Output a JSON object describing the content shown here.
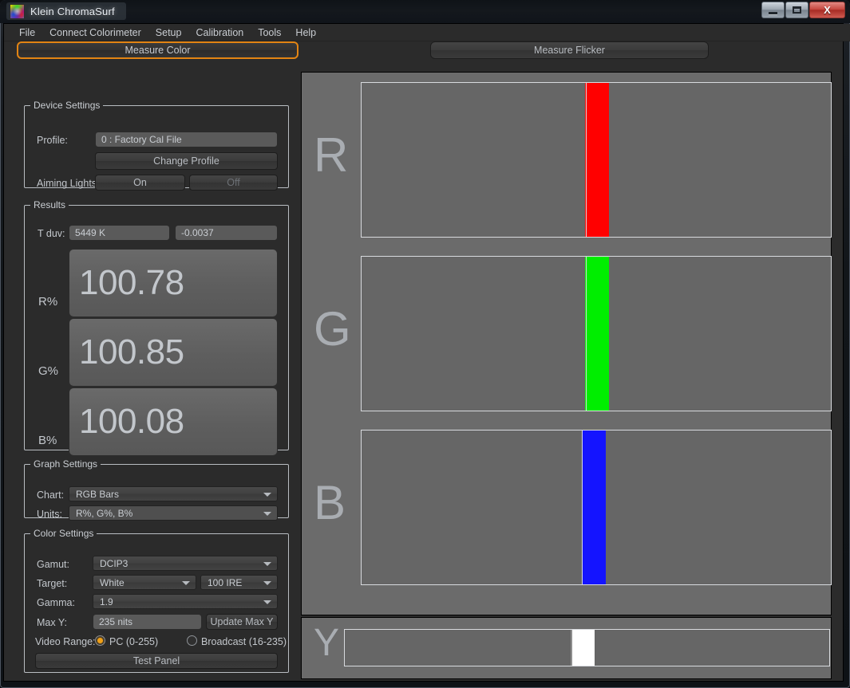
{
  "window": {
    "title": "Klein ChromaSurf",
    "icon": "chromaticity-gradient-icon",
    "minimize_label": "Minimize",
    "maximize_label": "Maximize",
    "close_label": "X"
  },
  "menu": {
    "items": [
      {
        "label": "File"
      },
      {
        "label": "Connect Colorimeter"
      },
      {
        "label": "Setup"
      },
      {
        "label": "Calibration"
      },
      {
        "label": "Tools"
      },
      {
        "label": "Help"
      }
    ]
  },
  "modes": {
    "measure_color": "Measure Color",
    "measure_flicker": "Measure Flicker",
    "active": "Measure Color",
    "active_color": "#e28413"
  },
  "device_settings": {
    "title": "Device Settings",
    "profile_label": "Profile:",
    "profile_value": "0 : Factory Cal File",
    "change_profile_button": "Change Profile",
    "aiming_lights_label": "Aiming Lights:",
    "aiming_on": "On",
    "aiming_off": "Off",
    "aiming_selected": "On"
  },
  "results": {
    "title": "Results",
    "tduv_label": "T duv:",
    "temperature": "5449 K",
    "duv": "-0.0037",
    "r_label": "R%",
    "r_value": "100.78",
    "g_label": "G%",
    "g_value": "100.85",
    "b_label": "B%",
    "b_value": "100.08"
  },
  "graph_settings": {
    "title": "Graph Settings",
    "chart_label": "Chart:",
    "chart_value": "RGB Bars",
    "units_label": "Units:",
    "units_value": "R%, G%, B%"
  },
  "color_settings": {
    "title": "Color Settings",
    "gamut_label": "Gamut:",
    "gamut_value": "DCIP3",
    "target_label": "Target:",
    "target_value": "White",
    "target_ire_value": "100 IRE",
    "gamma_label": "Gamma:",
    "gamma_value": "1.9",
    "maxy_label": "Max Y:",
    "maxy_value": "235 nits",
    "update_maxy_button": "Update Max Y",
    "video_range_label": "Video Range:",
    "video_range_pc": "PC (0-255)",
    "video_range_broadcast": "Broadcast (16-235)",
    "video_range_selected": "PC (0-255)",
    "test_panel_button": "Test Panel"
  },
  "chart_data": {
    "type": "bar",
    "title": "RGB Bars",
    "orientation": "horizontal",
    "units": "R%, G%, B%",
    "xlim": [
      0,
      200
    ],
    "grid": false,
    "legend": null,
    "categories": [
      "R",
      "G",
      "B",
      "Y"
    ],
    "series": [
      {
        "name": "R%",
        "value": 100.78,
        "color": "#ff0000",
        "reference": 100
      },
      {
        "name": "G%",
        "value": 100.85,
        "color": "#00ee00",
        "reference": 100
      },
      {
        "name": "B%",
        "value": 100.08,
        "color": "#1414ff",
        "reference": 100
      },
      {
        "name": "Y",
        "value": 100.0,
        "color": "#ffffff",
        "reference": 100
      }
    ],
    "reference_line_color": "#d8dade",
    "plot_background": "#666666",
    "panel_background": "#6b6b6b"
  },
  "channels": [
    {
      "letter": "R",
      "name": "red-channel",
      "color": "#ff0000",
      "bar_left_pct": 47.6,
      "bar_width_pct": 5.2,
      "split_pct": 2.3
    },
    {
      "letter": "G",
      "name": "green-channel",
      "color": "#00ee00",
      "bar_left_pct": 47.6,
      "bar_width_pct": 5.2,
      "split_pct": 2.3
    },
    {
      "letter": "B",
      "name": "blue-channel",
      "color": "#1414ff",
      "bar_left_pct": 46.9,
      "bar_width_pct": 5.2,
      "split_pct": 2.3
    }
  ],
  "y_channel": {
    "letter": "Y",
    "name": "luminance-channel",
    "color": "#ffffff",
    "bar_left_pct": 47.0,
    "bar_width_pct": 4.8,
    "split_pct": 1.5,
    "split_color": "#8e8e8e"
  }
}
